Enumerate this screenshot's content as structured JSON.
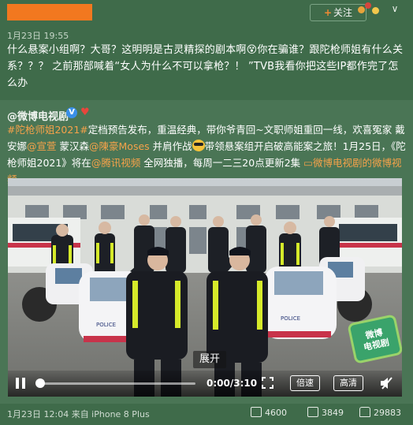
{
  "post": {
    "follow_label": "关注",
    "timestamp": "1月23日 19:55",
    "text": "什么悬案小组啊？大哥？这明明是古灵精探的剧本啊😵你在骗谁？跟陀枪师姐有什么关系？？？ 之前那部喊着“女人为什么不可以拿枪？！ ”TVB我看你把这些IP都作完了怎么办"
  },
  "repost": {
    "author": "@微博电视剧",
    "segments": [
      {
        "text": "#陀枪师姐2021#",
        "link": true
      },
      {
        "text": "定档预告发布，重温经典，带你爷青回~文职师姐重回一线，欢喜冤家 戴安娜",
        "link": false
      },
      {
        "text": "@宣萱",
        "link": true
      },
      {
        "text": " 蒙汉森",
        "link": false
      },
      {
        "text": "@陳豪Moses",
        "link": true
      },
      {
        "text": " 并肩作战",
        "link": false
      },
      {
        "text": "带领悬案组开启破高能案之旅！1月25日，《陀枪师姐2021》将在",
        "link": false
      },
      {
        "text": "@腾讯视频",
        "link": true
      },
      {
        "text": " 全网独播，每周一二三20点更新2集 ",
        "link": false
      },
      {
        "text": "▭微博电视剧的微博视频",
        "link": true
      }
    ],
    "video": {
      "expand_label": "展开",
      "time": "0:00/3:10",
      "progress": 0,
      "speed_label": "倍速",
      "quality_label": "高清",
      "watermark": "微博\n电视剧"
    }
  },
  "footer": {
    "timestamp": "1月23日 12:04 来自 iPhone 8 Plus",
    "reposts": "4600",
    "comments": "3849",
    "likes": "29883"
  },
  "colors": {
    "background": "#3f6b4a",
    "repost_background": "#4a7555",
    "link": "#f6a24a",
    "redaction": "#f2781f"
  }
}
